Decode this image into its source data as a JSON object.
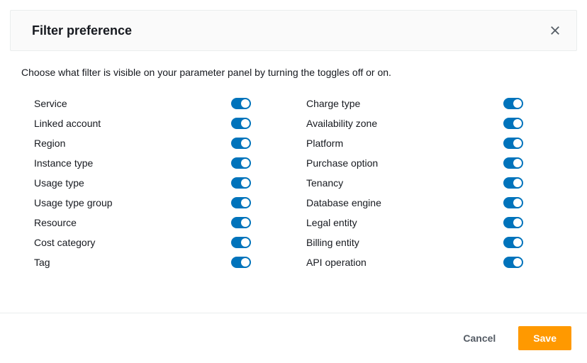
{
  "header": {
    "title": "Filter preference"
  },
  "body": {
    "description": "Choose what filter is visible on your parameter panel by turning the toggles off or on."
  },
  "filters_left": [
    {
      "label": "Service",
      "on": true
    },
    {
      "label": "Linked account",
      "on": true
    },
    {
      "label": "Region",
      "on": true
    },
    {
      "label": "Instance type",
      "on": true
    },
    {
      "label": "Usage type",
      "on": true
    },
    {
      "label": "Usage type group",
      "on": true
    },
    {
      "label": "Resource",
      "on": true
    },
    {
      "label": "Cost category",
      "on": true
    },
    {
      "label": "Tag",
      "on": true
    }
  ],
  "filters_right": [
    {
      "label": "Charge type",
      "on": true
    },
    {
      "label": "Availability zone",
      "on": true
    },
    {
      "label": "Platform",
      "on": true
    },
    {
      "label": "Purchase option",
      "on": true
    },
    {
      "label": "Tenancy",
      "on": true
    },
    {
      "label": "Database engine",
      "on": true
    },
    {
      "label": "Legal entity",
      "on": true
    },
    {
      "label": "Billing entity",
      "on": true
    },
    {
      "label": "API operation",
      "on": true
    }
  ],
  "footer": {
    "cancel_label": "Cancel",
    "save_label": "Save"
  }
}
